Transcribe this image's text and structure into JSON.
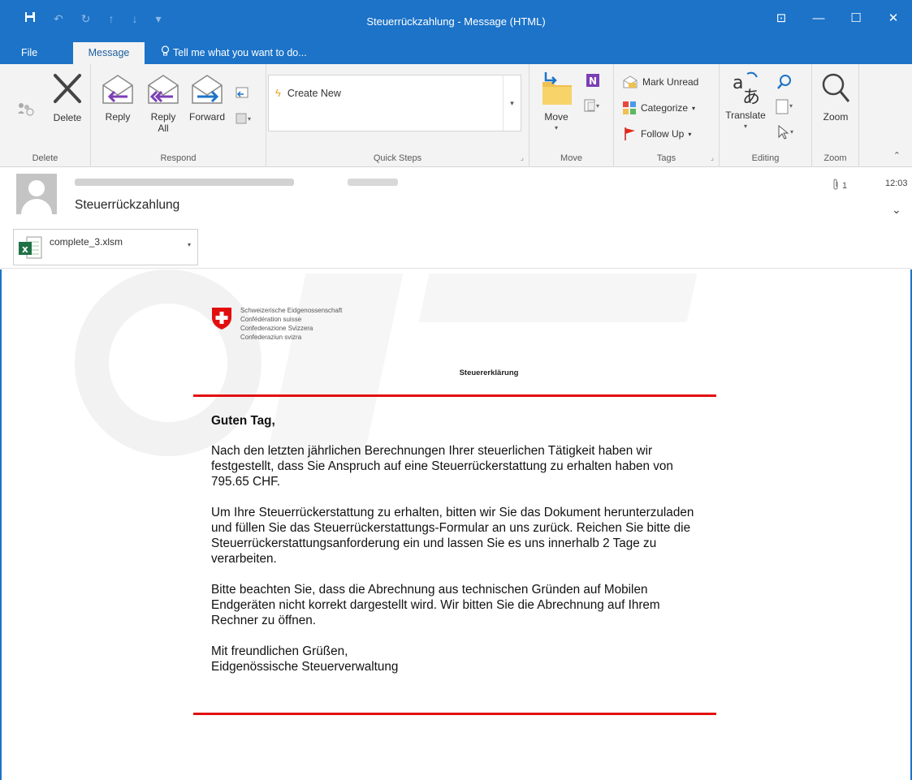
{
  "window": {
    "title": "Steuerrückzahlung - Message (HTML)",
    "controls": [
      "⊡",
      "—",
      "☐",
      "✕"
    ]
  },
  "tabs": {
    "file": "File",
    "message": "Message",
    "tell": "Tell me what you want to do..."
  },
  "ribbon": {
    "delete_group": {
      "label": "Delete",
      "delete": "Delete"
    },
    "respond_group": {
      "label": "Respond",
      "reply": "Reply",
      "reply_all_1": "Reply",
      "reply_all_2": "All",
      "forward": "Forward"
    },
    "quick_steps": {
      "label": "Quick Steps",
      "create_new": "Create New"
    },
    "move_group": {
      "label": "Move",
      "move": "Move"
    },
    "tags_group": {
      "label": "Tags",
      "mark_unread": "Mark Unread",
      "categorize": "Categorize",
      "follow_up": "Follow Up"
    },
    "editing_group": {
      "label": "Editing",
      "translate": "Translate"
    },
    "zoom_group": {
      "label": "Zoom",
      "zoom": "Zoom"
    }
  },
  "header": {
    "subject": "Steuerrückzahlung",
    "attachment_count": "1",
    "time": "12:03"
  },
  "attachment": {
    "name": "complete_3.xlsm"
  },
  "letter": {
    "logo_lines": [
      "Schweizerische Eidgenossenschaft",
      "Confédération suisse",
      "Confederazione Svizzera",
      "Confederaziun svizra"
    ],
    "doc_title": "Steuererklärung",
    "greeting": "Guten Tag,",
    "p1": "Nach den letzten jährlichen Berechnungen Ihrer steuerlichen Tätigkeit haben wir festgestellt, dass Sie Anspruch auf eine Steuerrückerstattung zu erhalten haben von 795.65 CHF.",
    "p2": "Um Ihre Steuerrückerstattung zu erhalten, bitten wir Sie das Dokument herunterzuladen und füllen Sie das Steuerrückerstattungs-Formular an uns zurück. Reichen Sie bitte die Steuerrückerstattungsanforderung ein und lassen Sie es uns innerhalb 2 Tage zu verarbeiten.",
    "p3": "Bitte beachten Sie, dass die Abrechnung aus technischen Gründen auf Mobilen Endgeräten nicht korrekt dargestellt wird. Wir bitten Sie die Abrechnung auf Ihrem Rechner zu öffnen.",
    "closing": "Mit freundlichen Grüßen,",
    "sender": "Eidgenössische Steuerverwaltung"
  },
  "colors": {
    "accent": "#1c73c8",
    "red_rule": "#e20e0e",
    "swiss_red": "#e20e0e"
  }
}
